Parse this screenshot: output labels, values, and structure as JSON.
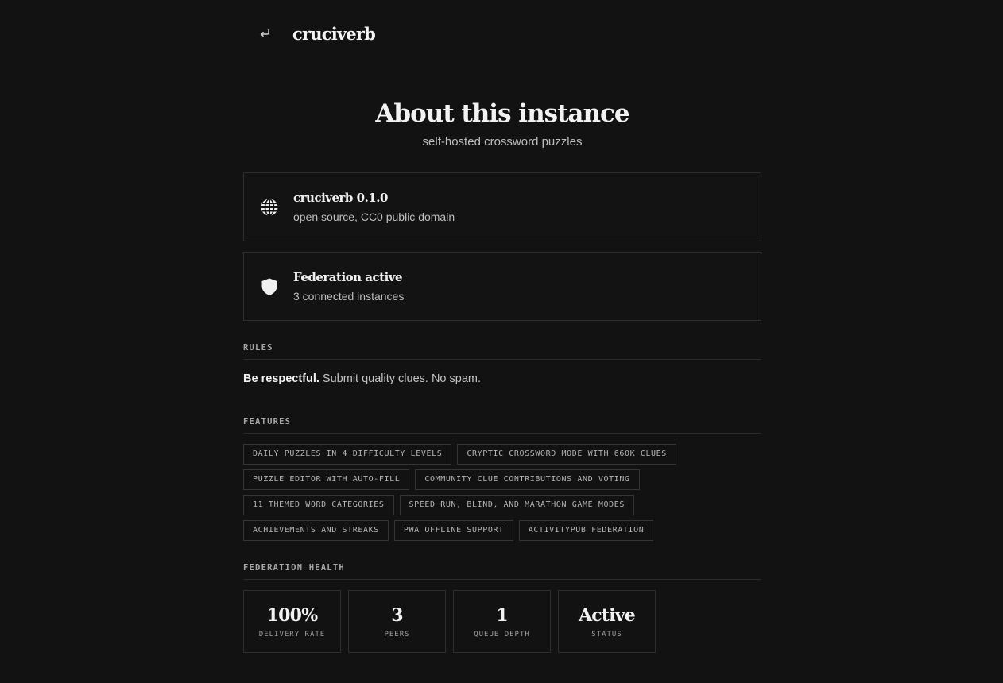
{
  "header": {
    "brand": "cruciverb",
    "back_icon": "return-arrow-icon"
  },
  "page": {
    "title": "About this instance",
    "subtitle": "self-hosted crossword puzzles"
  },
  "cards": [
    {
      "icon": "globe-icon",
      "title": "cruciverb 0.1.0",
      "subtitle": "open source, CC0 public domain"
    },
    {
      "icon": "shield-icon",
      "title": "Federation active",
      "subtitle": "3 connected instances"
    }
  ],
  "rules": {
    "label": "RULES",
    "bold": "Be respectful.",
    "text": " Submit quality clues. No spam."
  },
  "features": {
    "label": "FEATURES",
    "items": [
      "DAILY PUZZLES IN 4 DIFFICULTY LEVELS",
      "CRYPTIC CROSSWORD MODE WITH 660K CLUES",
      "PUZZLE EDITOR WITH AUTO-FILL",
      "COMMUNITY CLUE CONTRIBUTIONS AND VOTING",
      "11 THEMED WORD CATEGORIES",
      "SPEED RUN, BLIND, AND MARATHON GAME MODES",
      "ACHIEVEMENTS AND STREAKS",
      "PWA OFFLINE SUPPORT",
      "ACTIVITYPUB FEDERATION"
    ]
  },
  "health": {
    "label": "FEDERATION HEALTH",
    "stats": [
      {
        "value": "100%",
        "label": "DELIVERY RATE"
      },
      {
        "value": "3",
        "label": "PEERS"
      },
      {
        "value": "1",
        "label": "QUEUE DEPTH"
      },
      {
        "value": "Active",
        "label": "STATUS"
      }
    ]
  },
  "colors": {
    "background": "#121212",
    "border": "#2e2e2e",
    "text": "#e6e6e6"
  }
}
